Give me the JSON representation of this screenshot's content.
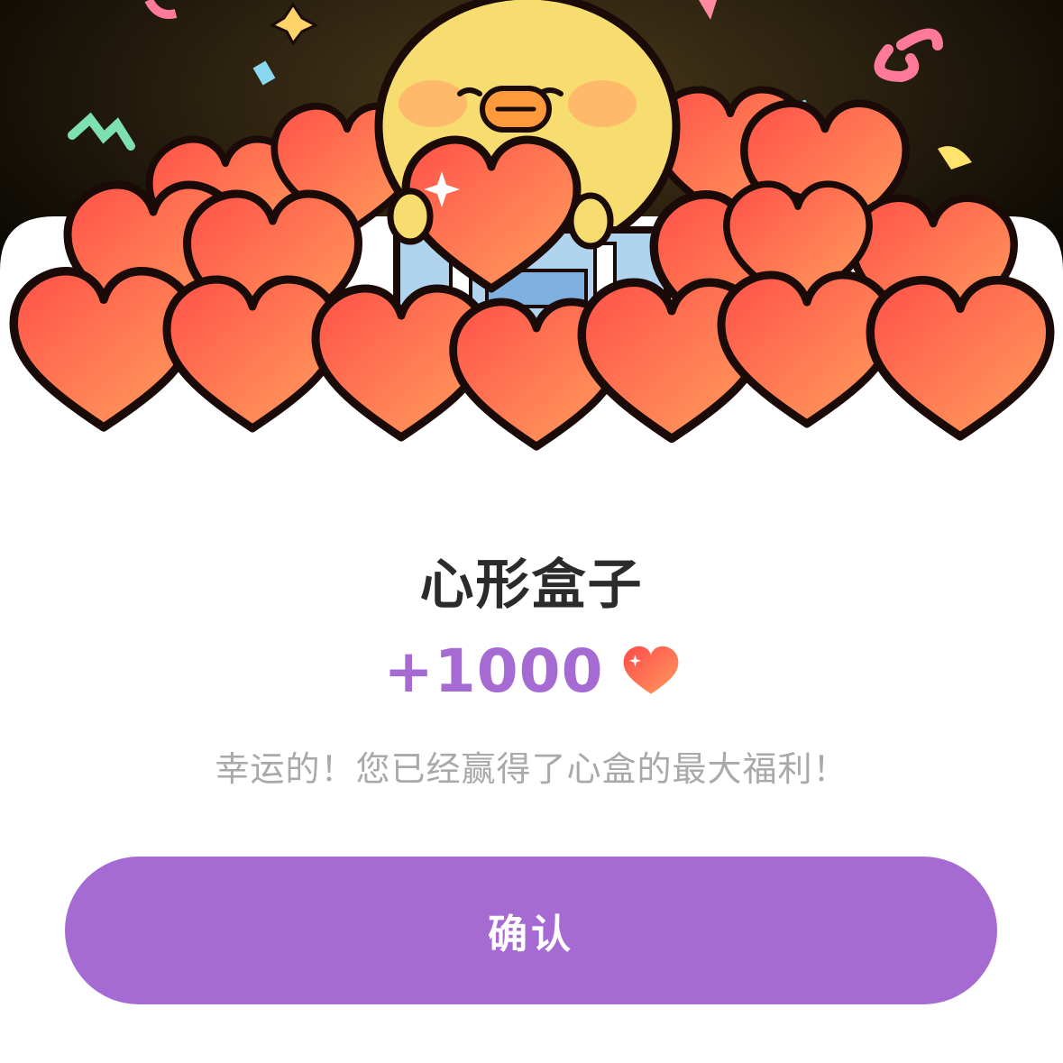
{
  "dialog": {
    "title": "心形盒子",
    "reward_amount": "+1000",
    "reward_icon": "heart-icon",
    "message": "幸运的！您已经赢得了心盒的最大福利！",
    "confirm_label": "确认"
  },
  "colors": {
    "accent": "#a66bd3",
    "title_text": "#2b2b2b",
    "message_text": "#a9a9a9",
    "heart_top": "#ff9b5e",
    "heart_bottom": "#ff4a4a",
    "chick": "#f7dc6f"
  }
}
